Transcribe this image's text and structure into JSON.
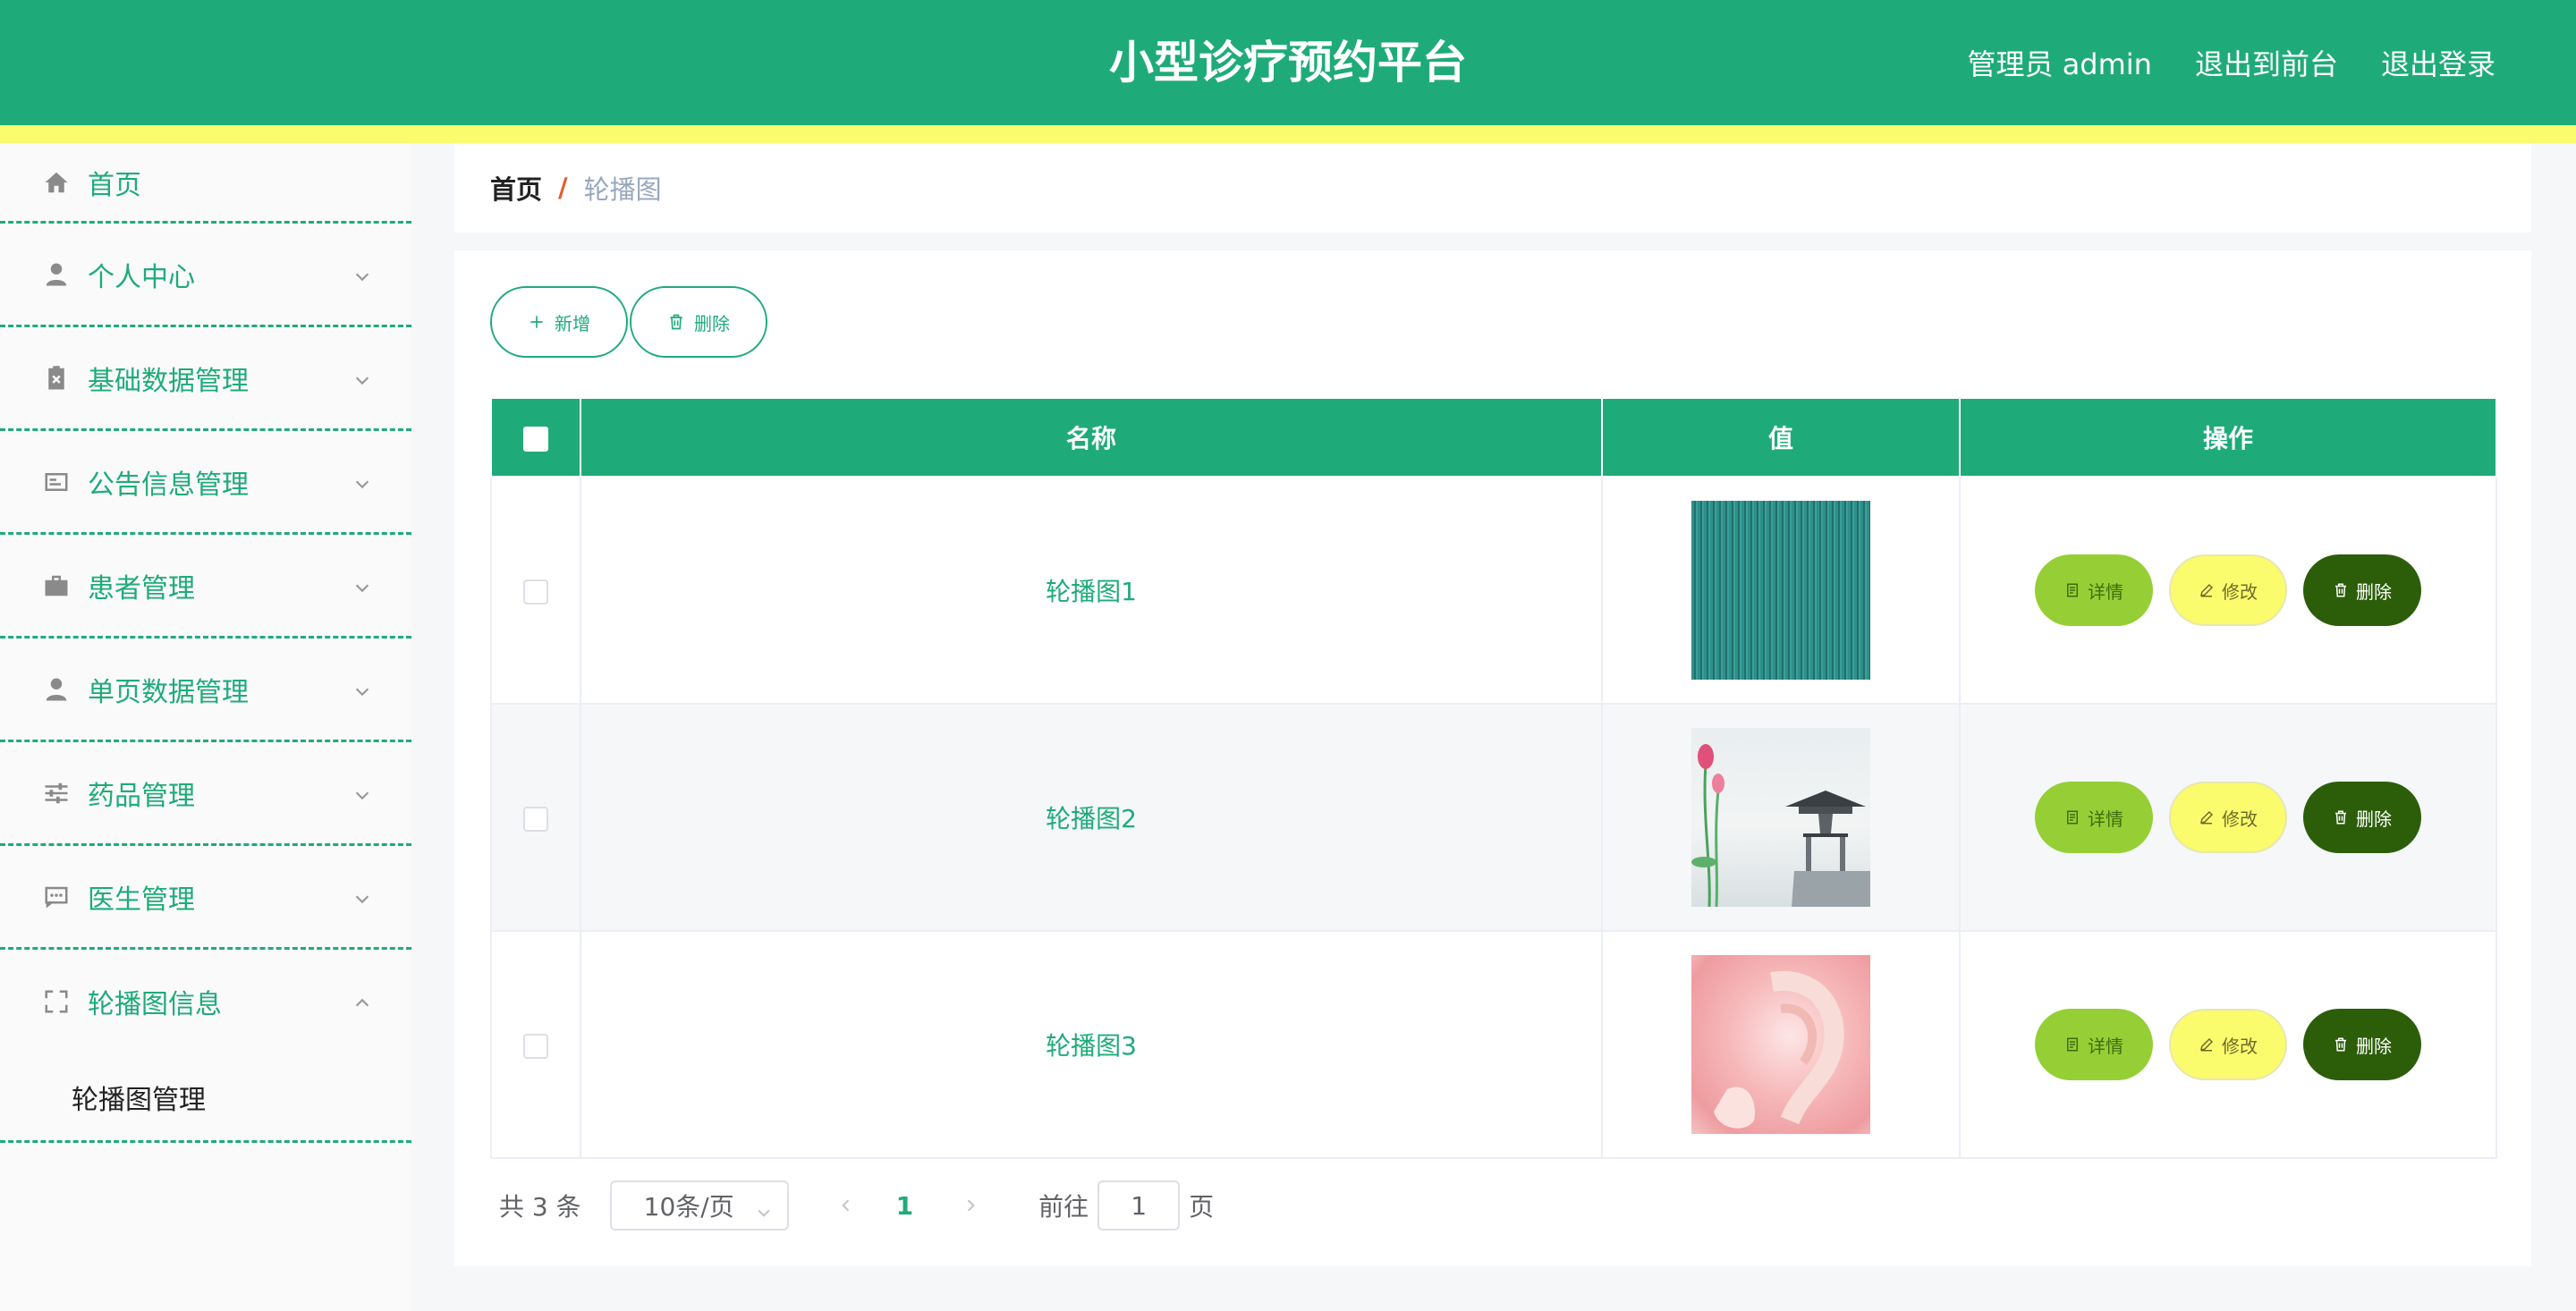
{
  "header": {
    "title": "小型诊疗预约平台",
    "admin_label": "管理员 admin",
    "to_front_label": "退出到前台",
    "logout_label": "退出登录"
  },
  "sidebar": {
    "items": [
      {
        "label": "首页",
        "icon": "home-icon"
      },
      {
        "label": "个人中心",
        "icon": "user-icon"
      },
      {
        "label": "基础数据管理",
        "icon": "clipboard-icon"
      },
      {
        "label": "公告信息管理",
        "icon": "id-card-icon"
      },
      {
        "label": "患者管理",
        "icon": "briefcase-icon"
      },
      {
        "label": "单页数据管理",
        "icon": "user-icon"
      },
      {
        "label": "药品管理",
        "icon": "sliders-icon"
      },
      {
        "label": "医生管理",
        "icon": "chat-icon"
      },
      {
        "label": "轮播图信息",
        "icon": "fullscreen-icon"
      }
    ],
    "subitem": "轮播图管理"
  },
  "breadcrumb": {
    "home": "首页",
    "sep": "/",
    "current": "轮播图"
  },
  "toolbar": {
    "add_label": "新增",
    "delete_label": "删除"
  },
  "table": {
    "columns": [
      "名称",
      "值",
      "操作"
    ],
    "rows": [
      {
        "name": "轮播图1"
      },
      {
        "name": "轮播图2"
      },
      {
        "name": "轮播图3"
      }
    ],
    "actions": {
      "detail": "详情",
      "edit": "修改",
      "delete": "删除"
    }
  },
  "pagination": {
    "total": "共 3 条",
    "page_size": "10条/页",
    "current_page": "1",
    "goto_label": "前往",
    "goto_value": "1",
    "page_suffix": "页"
  },
  "colors": {
    "primary": "#1fab79",
    "accent_strip": "#fbfb6e",
    "detail_button": "#95cf35",
    "edit_button": "#fbfb6e",
    "delete_button": "#2c5e0a"
  }
}
